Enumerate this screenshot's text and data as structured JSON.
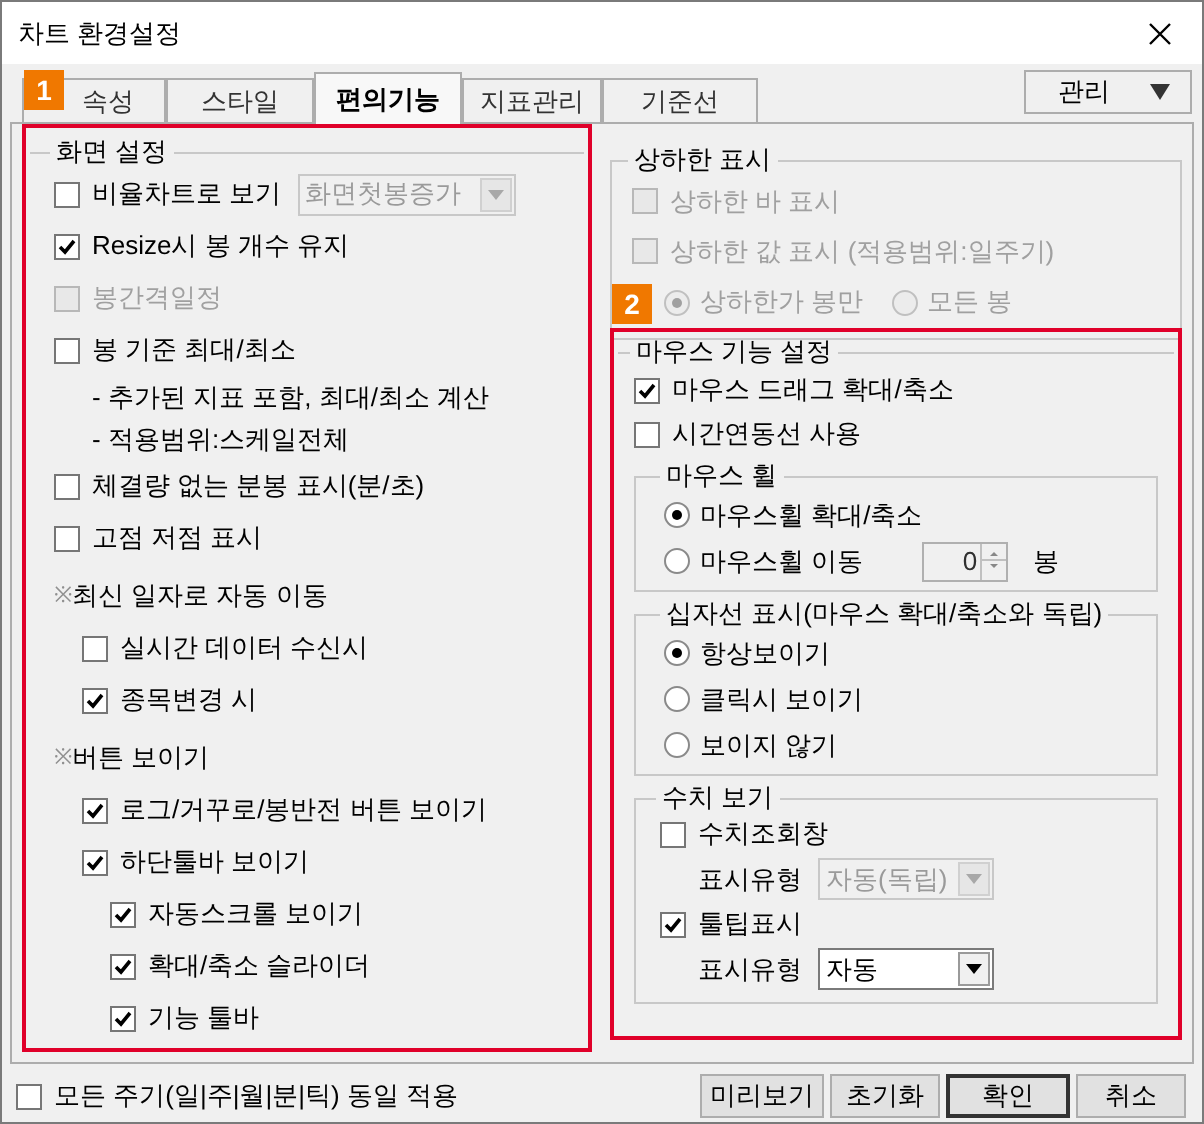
{
  "window": {
    "title": "차트 환경설정"
  },
  "tabs": [
    {
      "label": "속성",
      "selected": false
    },
    {
      "label": "스타일",
      "selected": false
    },
    {
      "label": "편의기능",
      "selected": true
    },
    {
      "label": "지표관리",
      "selected": false
    },
    {
      "label": "기준선",
      "selected": false
    }
  ],
  "manage_menu": {
    "label": "관리"
  },
  "annotations": [
    {
      "label": "1"
    },
    {
      "label": "2"
    }
  ],
  "screen_settings": {
    "title": "화면 설정",
    "items": [
      {
        "kind": "checkbox",
        "label": "비율차트로 보기",
        "checked": false,
        "disabled": false,
        "dropdown": {
          "value": "화면첫봉증가",
          "disabled": true
        }
      },
      {
        "kind": "checkbox",
        "label": "Resize시 봉 개수 유지",
        "checked": true,
        "disabled": false
      },
      {
        "kind": "checkbox",
        "label": "봉간격일정",
        "checked": false,
        "disabled": true
      },
      {
        "kind": "checkbox",
        "label": "봉 기준 최대/최소",
        "checked": false,
        "disabled": false,
        "notes": [
          "- 추가된 지표 포함, 최대/최소 계산",
          "- 적용범위:스케일전체"
        ]
      },
      {
        "kind": "checkbox",
        "label": "체결량 없는 분봉 표시(분/초)",
        "checked": false,
        "disabled": false
      },
      {
        "kind": "checkbox",
        "label": "고점 저점 표시",
        "checked": false,
        "disabled": false
      },
      {
        "kind": "heading",
        "mark": "※",
        "label": "최신 일자로 자동 이동",
        "children": [
          {
            "kind": "checkbox",
            "label": "실시간 데이터 수신시",
            "checked": false,
            "disabled": false
          },
          {
            "kind": "checkbox",
            "label": "종목변경 시",
            "checked": true,
            "disabled": false
          }
        ]
      },
      {
        "kind": "heading",
        "mark": "※",
        "label": "버튼 보이기",
        "children": [
          {
            "kind": "checkbox",
            "label": "로그/거꾸로/봉반전 버튼 보이기",
            "checked": true,
            "disabled": false
          },
          {
            "kind": "checkbox",
            "label": "하단툴바 보이기",
            "checked": true,
            "disabled": false,
            "children": [
              {
                "kind": "checkbox",
                "label": "자동스크롤 보이기",
                "checked": true,
                "disabled": false
              },
              {
                "kind": "checkbox",
                "label": "확대/축소 슬라이더",
                "checked": true,
                "disabled": false
              },
              {
                "kind": "checkbox",
                "label": "기능 툴바",
                "checked": true,
                "disabled": false
              }
            ]
          }
        ]
      }
    ]
  },
  "limit_display": {
    "title": "상하한 표시",
    "disabled": true,
    "checkboxes": [
      {
        "label": "상하한 바 표시",
        "checked": false
      },
      {
        "label": "상하한 값 표시 (적용범위:일주기)",
        "checked": false
      }
    ],
    "radios": [
      {
        "label": "상하한가 봉만",
        "selected": true
      },
      {
        "label": "모든 봉",
        "selected": false
      }
    ]
  },
  "mouse_settings": {
    "title": "마우스 기능 설정",
    "checkboxes": [
      {
        "label": "마우스 드래그 확대/축소",
        "checked": true
      },
      {
        "label": "시간연동선 사용",
        "checked": false
      }
    ],
    "wheel": {
      "title": "마우스 휠",
      "options": [
        {
          "label": "마우스휠 확대/축소",
          "selected": true
        },
        {
          "label": "마우스휠 이동",
          "selected": false,
          "spin": {
            "value": "0",
            "disabled": true
          },
          "unit": "봉"
        }
      ]
    },
    "crosshair": {
      "title": "십자선 표시(마우스 확대/축소와 독립)",
      "options": [
        {
          "label": "항상보이기",
          "selected": true
        },
        {
          "label": "클릭시 보이기",
          "selected": false
        },
        {
          "label": "보이지 않기",
          "selected": false
        }
      ]
    },
    "values": {
      "title": "수치 보기",
      "items": [
        {
          "label": "수치조회창",
          "checked": false,
          "type_label": "표시유형",
          "dropdown": {
            "value": "자동(독립)",
            "disabled": true
          }
        },
        {
          "label": "툴팁표시",
          "checked": true,
          "type_label": "표시유형",
          "dropdown": {
            "value": "자동",
            "disabled": false
          }
        }
      ]
    }
  },
  "apply_all": {
    "label": "모든 주기(일|주|월|분|틱) 동일 적용",
    "checked": false
  },
  "buttons": [
    {
      "label": "미리보기",
      "default": false
    },
    {
      "label": "초기화",
      "default": false
    },
    {
      "label": "확인",
      "default": true
    },
    {
      "label": "취소",
      "default": false
    }
  ]
}
